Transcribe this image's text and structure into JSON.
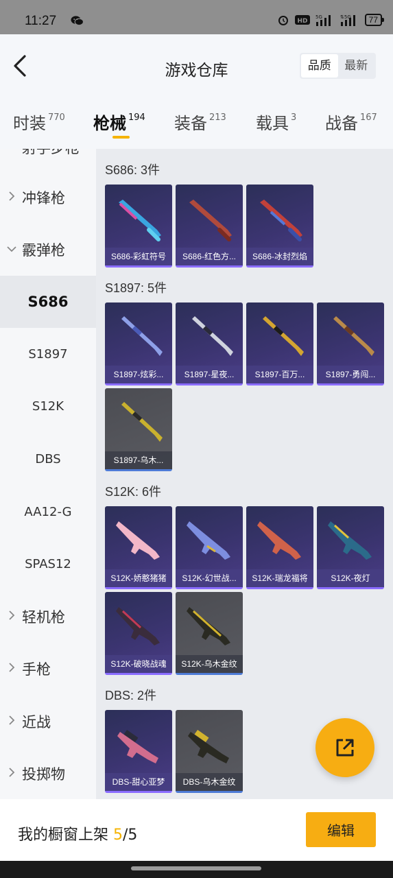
{
  "status": {
    "time": "11:27",
    "battery": "77"
  },
  "header": {
    "title": "游戏仓库",
    "sort_quality": "品质",
    "sort_newest": "最新"
  },
  "tabs": [
    {
      "label": "时装",
      "count": "770"
    },
    {
      "label": "枪械",
      "count": "194"
    },
    {
      "label": "装备",
      "count": "213"
    },
    {
      "label": "载具",
      "count": "3"
    },
    {
      "label": "战备",
      "count": "167"
    }
  ],
  "sidebar": {
    "cutoff": "射手步枪",
    "items": [
      {
        "label": "冲锋枪"
      },
      {
        "label": "霰弹枪"
      },
      {
        "label": "S686"
      },
      {
        "label": "S1897"
      },
      {
        "label": "S12K"
      },
      {
        "label": "DBS"
      },
      {
        "label": "AA12-G"
      },
      {
        "label": "SPAS12"
      },
      {
        "label": "轻机枪"
      },
      {
        "label": "手枪"
      },
      {
        "label": "近战"
      },
      {
        "label": "投掷物"
      }
    ]
  },
  "groups": [
    {
      "title": "S686: 3件",
      "items": [
        "S686-彩虹符号",
        "S686-红色方...",
        "S686-冰封烈焰"
      ]
    },
    {
      "title": "S1897: 5件",
      "items": [
        "S1897-炫彩...",
        "S1897-星夜...",
        "S1897-百万...",
        "S1897-勇闯...",
        "S1897-乌木..."
      ]
    },
    {
      "title": "S12K: 6件",
      "items": [
        "S12K-娇憨猪猪",
        "S12K-幻世战...",
        "S12K-瑞龙福将",
        "S12K-夜灯",
        "S12K-破晓战魂",
        "S12K-乌木金纹"
      ]
    },
    {
      "title": "DBS: 2件",
      "items": [
        "DBS-甜心亚梦",
        "DBS-乌木金纹"
      ]
    }
  ],
  "bottom": {
    "shelf_label": "我的橱窗上架",
    "shelf_current": "5",
    "shelf_total": "/5",
    "edit_label": "编辑"
  },
  "colors": {
    "accent": "#f7ad12",
    "card_purple": "#3b3470",
    "card_gray": "#55565c"
  }
}
